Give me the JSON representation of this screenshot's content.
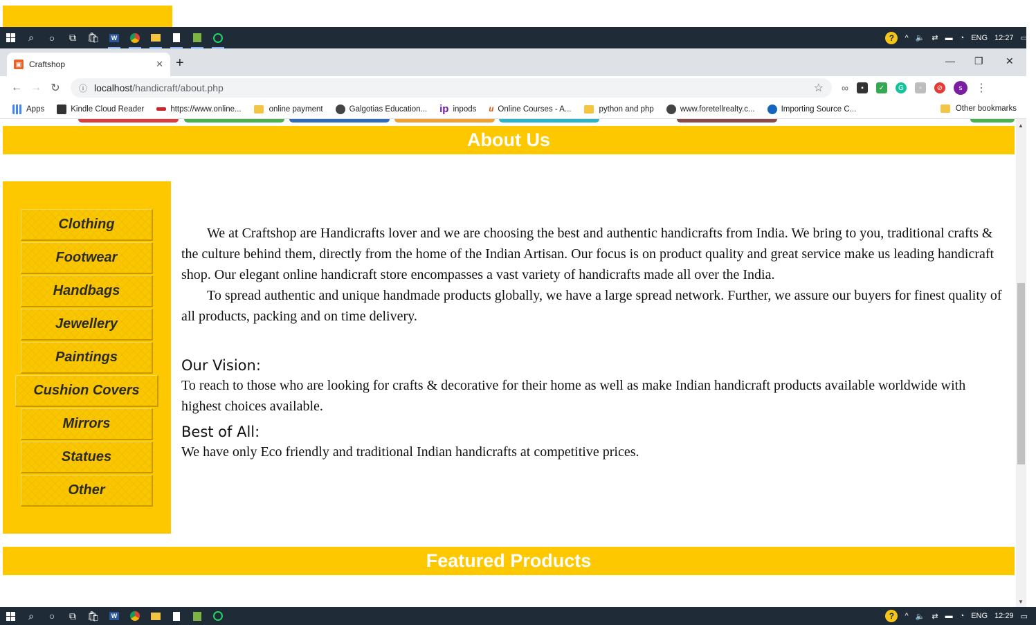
{
  "taskbar": {
    "help_label": "?",
    "lang": "ENG",
    "time_top": "12:27",
    "time_bottom": "12:29"
  },
  "browser": {
    "tab_title": "Craftshop",
    "url_host": "localhost",
    "url_path": "/handicraft/about.php",
    "profile_initial": "s"
  },
  "bookmarks": {
    "items": [
      "Apps",
      "Kindle Cloud Reader",
      "https://www.online...",
      "online payment",
      "Galgotias Education...",
      "inpods",
      "Online Courses - A...",
      "python and php",
      "www.foretellrealty.c...",
      "Importing Source C..."
    ],
    "other": "Other bookmarks"
  },
  "page": {
    "about_title": "About Us",
    "sidebar": [
      "Clothing",
      "Footwear",
      "Handbags",
      "Jewellery",
      "Paintings",
      "Cushion Covers",
      "Mirrors",
      "Statues",
      "Other"
    ],
    "para1": "We at Craftshop are Handicrafts lover and we are choosing the best and authentic handicrafts from India. We bring to you, traditional crafts & the culture behind them, directly from the home of the Indian Artisan. Our focus is on product quality and great service make us leading handicraft shop. Our elegant online handicraft store encompasses a vast variety of handicrafts made all over the India.",
    "para2": "To spread authentic and unique handmade products globally, we have a large spread network. Further, we assure our buyers for finest quality of all products, packing and on time delivery.",
    "vision_heading": "Our Vision:",
    "vision_text": "To reach to those who are looking for crafts & decorative for their home as well as make Indian handicraft products available worldwide with highest choices available.",
    "best_heading": "Best of All:",
    "best_text": "We have only Eco friendly and traditional Indian handicrafts at competitive prices.",
    "featured_title": "Featured Products"
  },
  "colors": {
    "accent_yellow": "#fdc800",
    "taskbar": "#1f2b36"
  }
}
